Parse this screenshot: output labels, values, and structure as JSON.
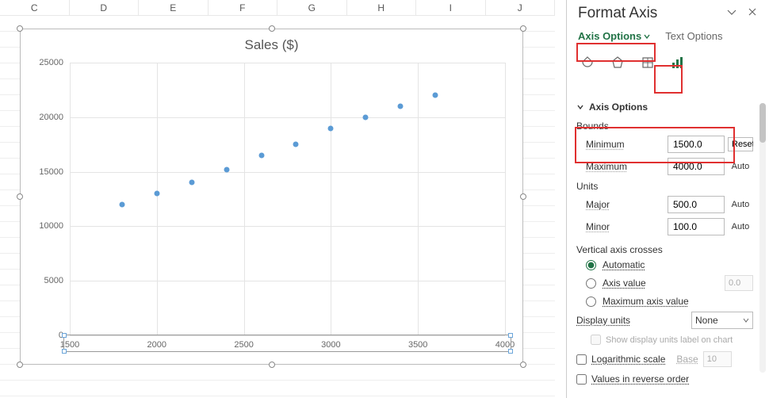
{
  "columns": [
    "C",
    "D",
    "E",
    "F",
    "G",
    "H",
    "I",
    "J"
  ],
  "chart_data": {
    "type": "scatter",
    "title": "Sales ($)",
    "xlabel": "",
    "ylabel": "",
    "xlim": [
      1500,
      4000
    ],
    "ylim": [
      0,
      25000
    ],
    "x_ticks": [
      1500,
      2000,
      2500,
      3000,
      3500,
      4000
    ],
    "y_ticks": [
      0,
      5000,
      10000,
      15000,
      20000,
      25000
    ],
    "y_major_unit": 5000,
    "x_major_unit": 500,
    "series": [
      {
        "name": "Sales",
        "x": [
          1800,
          2000,
          2200,
          2400,
          2600,
          2800,
          3000,
          3200,
          3400,
          3600
        ],
        "y": [
          12000,
          13000,
          14000,
          15200,
          16500,
          17500,
          19000,
          20000,
          21000,
          22000
        ]
      }
    ]
  },
  "panel": {
    "title": "Format Axis",
    "tabs": {
      "axis_options": "Axis Options",
      "text_options": "Text Options"
    },
    "section": "Axis Options",
    "bounds_label": "Bounds",
    "min_label": "Minimum",
    "min_value": "1500.0",
    "min_side": "Reset",
    "max_label": "Maximum",
    "max_value": "4000.0",
    "max_side": "Auto",
    "units_label": "Units",
    "major_label": "Major",
    "major_value": "500.0",
    "major_side": "Auto",
    "minor_label": "Minor",
    "minor_value": "100.0",
    "minor_side": "Auto",
    "crosses_label": "Vertical axis crosses",
    "radio_auto": "Automatic",
    "radio_axisval": "Axis value",
    "axisval_value": "0.0",
    "radio_maxval": "Maximum axis value",
    "display_units_label": "Display units",
    "display_units_value": "None",
    "show_label_cb": "Show display units label on chart",
    "log_label": "Logarithmic scale",
    "log_base_label": "Base",
    "log_base_value": "10",
    "reverse_label": "Values in reverse order"
  }
}
